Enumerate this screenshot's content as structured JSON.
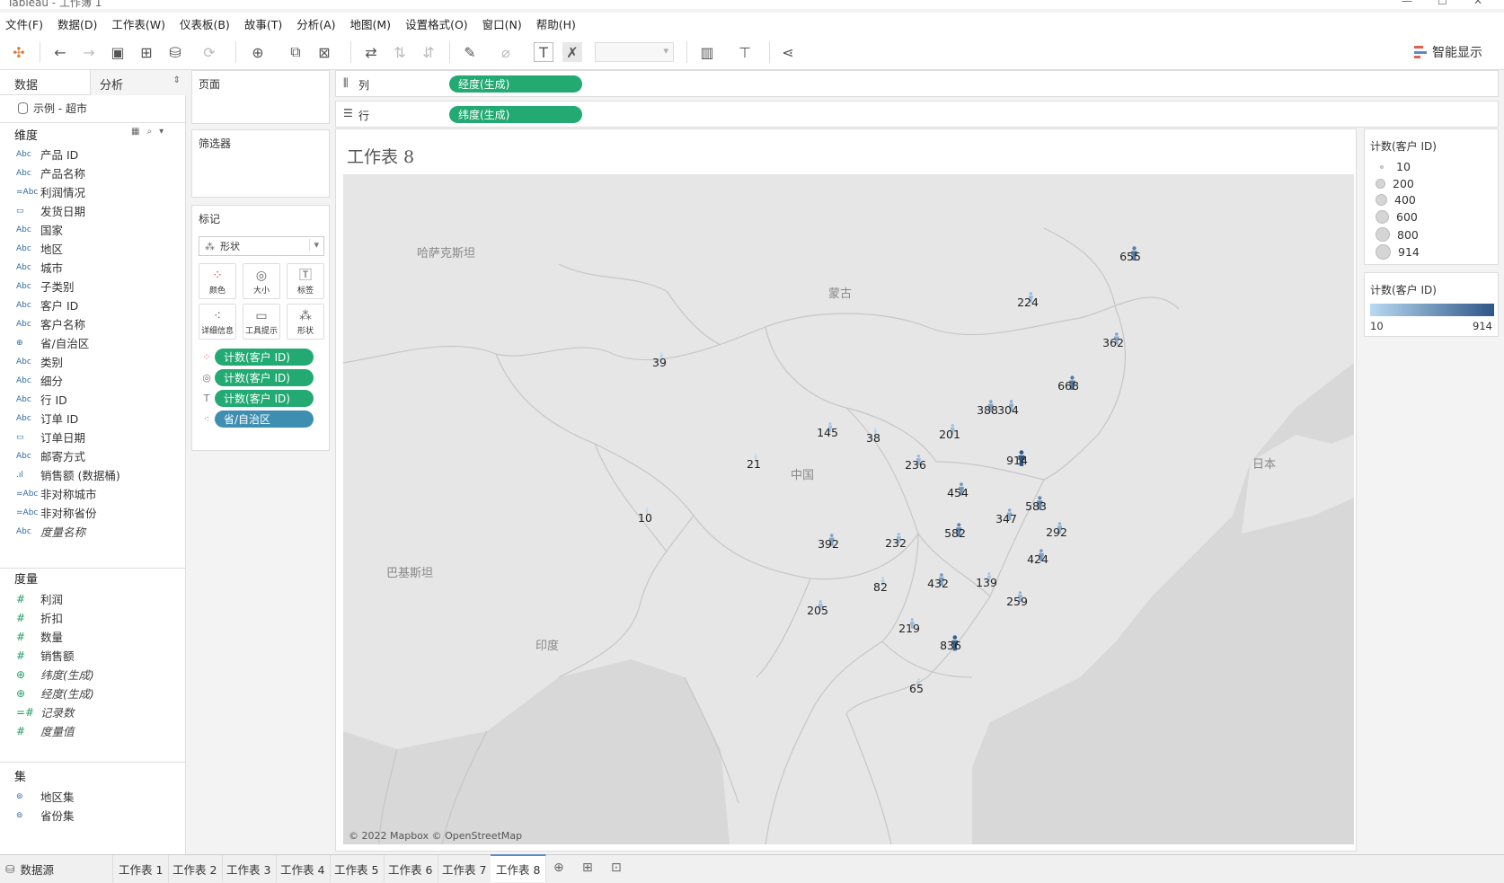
{
  "window": {
    "title": "Tableau - 工作簿 1"
  },
  "menu": [
    "文件(F)",
    "数据(D)",
    "工作表(W)",
    "仪表板(B)",
    "故事(T)",
    "分析(A)",
    "地图(M)",
    "设置格式(O)",
    "窗口(N)",
    "帮助(H)"
  ],
  "toolbar": {
    "smart_show": "智能显示"
  },
  "data_pane": {
    "tab_data": "数据",
    "tab_analysis": "分析",
    "datasource": "示例 - 超市",
    "dimensions_title": "维度",
    "dimensions": [
      {
        "type": "Abc",
        "name": "产品 ID"
      },
      {
        "type": "Abc",
        "name": "产品名称"
      },
      {
        "type": "=Abc",
        "name": "利润情况"
      },
      {
        "type": "date",
        "name": "发货日期"
      },
      {
        "type": "Abc",
        "name": "国家"
      },
      {
        "type": "Abc",
        "name": "地区"
      },
      {
        "type": "Abc",
        "name": "城市"
      },
      {
        "type": "Abc",
        "name": "子类别"
      },
      {
        "type": "Abc",
        "name": "客户 ID"
      },
      {
        "type": "Abc",
        "name": "客户名称"
      },
      {
        "type": "geo",
        "name": "省/自治区"
      },
      {
        "type": "Abc",
        "name": "类别"
      },
      {
        "type": "Abc",
        "name": "细分"
      },
      {
        "type": "Abc",
        "name": "行 ID"
      },
      {
        "type": "Abc",
        "name": "订单 ID"
      },
      {
        "type": "date",
        "name": "订单日期"
      },
      {
        "type": "Abc",
        "name": "邮寄方式"
      },
      {
        "type": "bin",
        "name": "销售额 (数据桶)"
      },
      {
        "type": "=Abc",
        "name": "非对称城市"
      },
      {
        "type": "=Abc",
        "name": "非对称省份"
      },
      {
        "type": "Abc",
        "name": "度量名称",
        "italic": true
      }
    ],
    "measures_title": "度量",
    "measures": [
      {
        "type": "#",
        "name": "利润"
      },
      {
        "type": "#",
        "name": "折扣"
      },
      {
        "type": "#",
        "name": "数量"
      },
      {
        "type": "#",
        "name": "销售额"
      },
      {
        "type": "geo",
        "name": "纬度(生成)",
        "italic": true
      },
      {
        "type": "geo",
        "name": "经度(生成)",
        "italic": true
      },
      {
        "type": "=#",
        "name": "记录数",
        "italic": true
      },
      {
        "type": "#",
        "name": "度量值",
        "italic": true
      }
    ],
    "sets_title": "集",
    "sets": [
      {
        "type": "set",
        "name": "地区集"
      },
      {
        "type": "set",
        "name": "省份集"
      }
    ]
  },
  "cards": {
    "pages": "页面",
    "filters": "筛选器",
    "marks": "标记",
    "marks_type": "形状",
    "mark_buttons": [
      "颜色",
      "大小",
      "标签",
      "详细信息",
      "工具提示",
      "形状"
    ],
    "mark_pills": [
      "计数(客户 ID)",
      "计数(客户 ID)",
      "计数(客户 ID)",
      "省/自治区"
    ]
  },
  "shelves": {
    "columns_label": "列",
    "columns_pill": "经度(生成)",
    "rows_label": "行",
    "rows_pill": "纬度(生成)"
  },
  "sheet": {
    "title": "工作表 8",
    "attribution": "© 2022 Mapbox © OpenStreetMap",
    "places": [
      "哈萨克斯坦",
      "蒙古",
      "中国",
      "巴基斯坦",
      "印度",
      "日本"
    ],
    "values": [
      "655",
      "224",
      "362",
      "668",
      "388",
      "304",
      "39",
      "145",
      "38",
      "201",
      "914",
      "21",
      "236",
      "454",
      "583",
      "347",
      "292",
      "10",
      "392",
      "232",
      "582",
      "424",
      "82",
      "432",
      "139",
      "259",
      "205",
      "219",
      "836",
      "65"
    ]
  },
  "legends": {
    "size_title": "计数(客户 ID)",
    "size_items": [
      "10",
      "200",
      "400",
      "600",
      "800",
      "914"
    ],
    "color_title": "计数(客户 ID)",
    "color_min": "10",
    "color_max": "914",
    "color_low": "#b9d9f2",
    "color_high": "#2d5687"
  },
  "bottom_tabs": {
    "datasource": "数据源",
    "sheets": [
      "工作表 1",
      "工作表 2",
      "工作表 3",
      "工作表 4",
      "工作表 5",
      "工作表 6",
      "工作表 7",
      "工作表 8"
    ],
    "active": "工作表 8"
  }
}
